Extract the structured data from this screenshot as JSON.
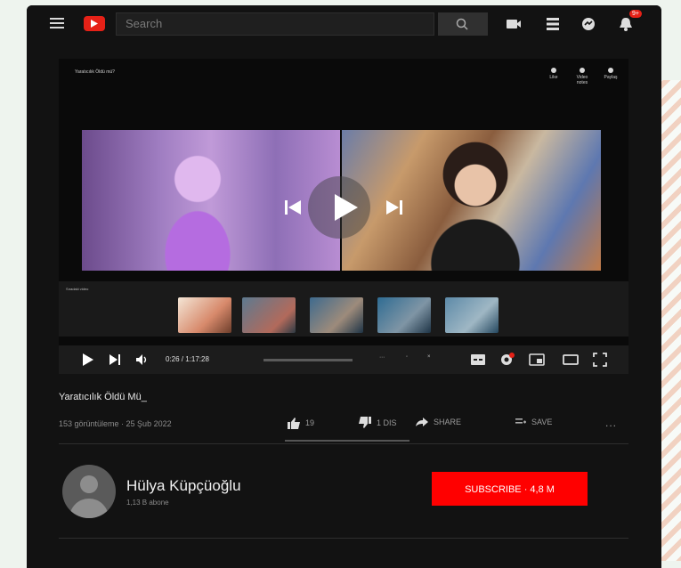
{
  "topbar": {
    "search_placeholder": "Search",
    "notification_count": "9+"
  },
  "video": {
    "overlay_title": "Yaratıcılık Öldü mü?",
    "overlay_actions": [
      "Like",
      "Video notes",
      "Paylaş"
    ],
    "thumbs_label": "Sıradaki video",
    "time": "0:26 / 1:17:28",
    "playback_progress": 0.22,
    "buffered_progress": 0.56
  },
  "info": {
    "title": "Yaratıcılık Öldü Mü_",
    "meta": "153 görüntüleme · 25 Şub 2022",
    "like_count": "19",
    "dislike_label": "1 DIS",
    "share_label": "SHARE",
    "save_label": "SAVE",
    "more_label": "..."
  },
  "channel": {
    "name": "Hülya Küpçüoğlu",
    "subscribers": "1,13 B abone",
    "subscribe_label": "SUBSCRIBE · 4,8 M"
  },
  "colors": {
    "accent": "#ff0000",
    "background": "#121212"
  }
}
